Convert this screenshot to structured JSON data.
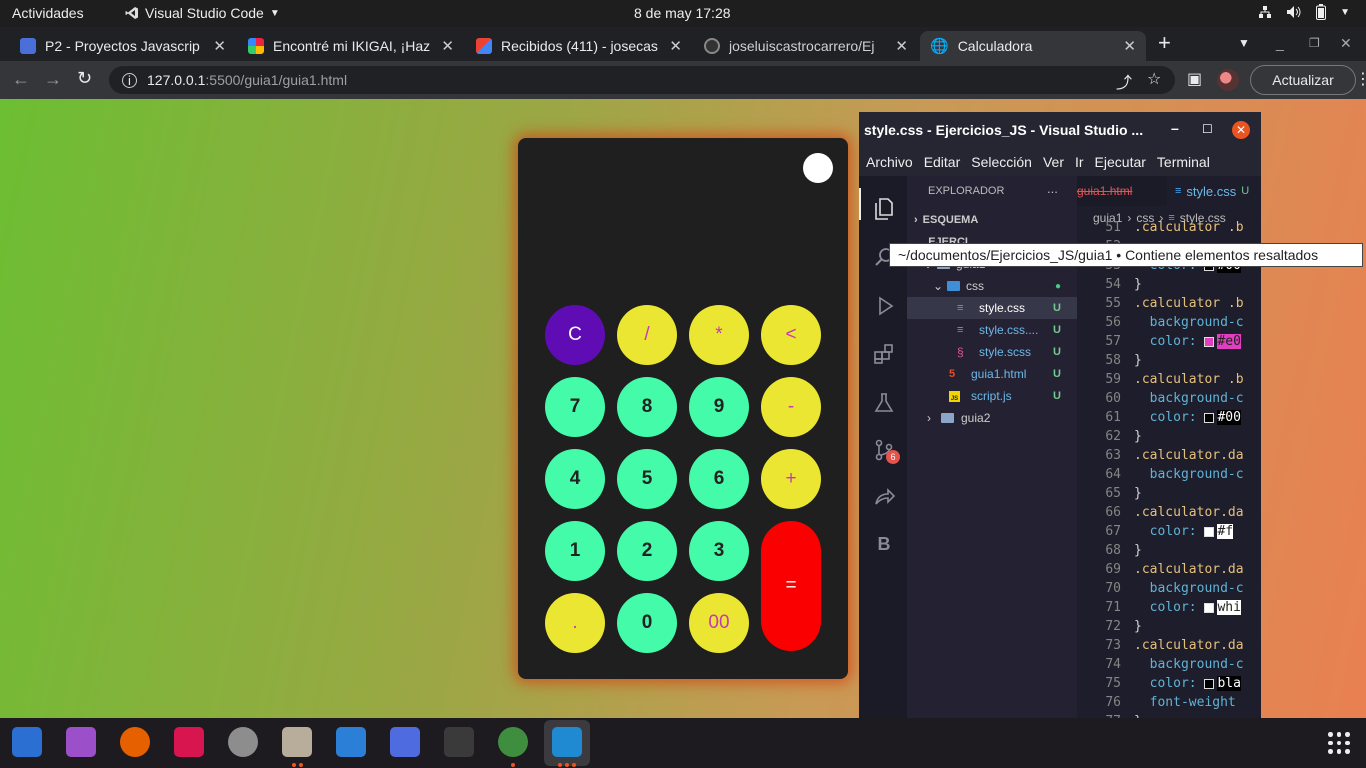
{
  "topbar": {
    "activities": "Actividades",
    "app": "Visual Studio Code",
    "app_menu_icon": "chevron-down-icon",
    "clock": "8 de may  17:28",
    "tray_icons": [
      "network-icon",
      "volume-icon",
      "battery-icon",
      "chevron-down-icon"
    ]
  },
  "browser": {
    "tabs": [
      {
        "title": "P2 - Proyectos Javascrip",
        "icon": "site-icon"
      },
      {
        "title": "Encontré mi IKIGAI, ¡Haz",
        "icon": "site-icon"
      },
      {
        "title": "Recibidos (411) - josecas",
        "icon": "gmail-icon"
      },
      {
        "title": "joseluiscastrocarrero/Ej",
        "icon": "github-icon"
      },
      {
        "title": "Calculadora",
        "icon": "globe-icon",
        "active": true
      }
    ],
    "new_tab": "+",
    "url_host": "127.0.0.1",
    "url_rest": ":5500/guia1/guia1.html",
    "update_label": "Actualizar"
  },
  "calculator": {
    "rows": [
      [
        {
          "label": "C",
          "kind": "clear"
        },
        {
          "label": "/",
          "kind": "op"
        },
        {
          "label": "*",
          "kind": "op"
        },
        {
          "label": "<",
          "kind": "op"
        }
      ],
      [
        {
          "label": "7",
          "kind": "num"
        },
        {
          "label": "8",
          "kind": "num"
        },
        {
          "label": "9",
          "kind": "num"
        },
        {
          "label": "-",
          "kind": "op"
        }
      ],
      [
        {
          "label": "4",
          "kind": "num"
        },
        {
          "label": "5",
          "kind": "num"
        },
        {
          "label": "6",
          "kind": "num"
        },
        {
          "label": "+",
          "kind": "op"
        }
      ],
      [
        {
          "label": "1",
          "kind": "num"
        },
        {
          "label": "2",
          "kind": "num"
        },
        {
          "label": "3",
          "kind": "num"
        },
        {
          "label": "=",
          "kind": "eq"
        }
      ],
      [
        {
          "label": ".",
          "kind": "op"
        },
        {
          "label": "0",
          "kind": "num"
        },
        {
          "label": "00",
          "kind": "op"
        }
      ]
    ],
    "colors": {
      "num": "#43fba9",
      "op": "#ebe631",
      "clear": "#5f0cb4",
      "eq": "#fa0000"
    }
  },
  "vscode": {
    "title": "style.css - Ejercicios_JS - Visual Studio ...",
    "menu": [
      "Archivo",
      "Editar",
      "Selección",
      "Ver",
      "Ir",
      "Ejecutar",
      "Terminal"
    ],
    "explorer_label": "EXPLORADOR",
    "explorer_more": "...",
    "outline": "ESQUEMA",
    "project": "EJERCI...",
    "files": [
      {
        "name": "guia1",
        "kind": "folder"
      },
      {
        "name": "css",
        "kind": "folder",
        "badge": "●"
      },
      {
        "name": "style.css",
        "kind": "css",
        "badge": "U",
        "selected": true
      },
      {
        "name": "style.css....",
        "kind": "css",
        "badge": "U"
      },
      {
        "name": "style.scss",
        "kind": "scss",
        "badge": "U"
      },
      {
        "name": "guia1.html",
        "kind": "html",
        "badge": "U"
      },
      {
        "name": "script.js",
        "kind": "js",
        "badge": "U"
      },
      {
        "name": "guia2",
        "kind": "folder"
      }
    ],
    "editor_tabs": [
      {
        "name": "guia1.html"
      },
      {
        "name": "style.css",
        "badge": "U"
      }
    ],
    "breadcrumb": [
      "guia1",
      "css",
      "style.css"
    ],
    "scm_badge": "6",
    "code": [
      {
        "n": "51",
        "t": ".calculator .b"
      },
      {
        "n": "52",
        "t": ""
      },
      {
        "n": "53",
        "t": "  color: ",
        "sw": "#000000",
        "v": "#00"
      },
      {
        "n": "54",
        "t": "}"
      },
      {
        "n": "55",
        "t": ".calculator .b"
      },
      {
        "n": "56",
        "t": "  background-c"
      },
      {
        "n": "57",
        "t": "  color: ",
        "sw": "#e040c0",
        "v": "#e0"
      },
      {
        "n": "58",
        "t": "}"
      },
      {
        "n": "59",
        "t": ".calculator .b"
      },
      {
        "n": "60",
        "t": "  background-c"
      },
      {
        "n": "61",
        "t": "  color: ",
        "sw": "#000000",
        "v": "#00"
      },
      {
        "n": "62",
        "t": "}"
      },
      {
        "n": "63",
        "t": ".calculator.da"
      },
      {
        "n": "64",
        "t": "  background-c"
      },
      {
        "n": "65",
        "t": "}"
      },
      {
        "n": "66",
        "t": ".calculator.da"
      },
      {
        "n": "67",
        "t": "  color: ",
        "sw": "#ffffff",
        "v": "#f"
      },
      {
        "n": "68",
        "t": "}"
      },
      {
        "n": "69",
        "t": ".calculator.da"
      },
      {
        "n": "70",
        "t": "  background-c"
      },
      {
        "n": "71",
        "t": "  color: ",
        "sw": "#ffffff",
        "v": "whi"
      },
      {
        "n": "72",
        "t": "}"
      },
      {
        "n": "73",
        "t": ".calculator.da"
      },
      {
        "n": "74",
        "t": "  background-c"
      },
      {
        "n": "75",
        "t": "  color: ",
        "sw": "#000000",
        "v": "bla"
      },
      {
        "n": "76",
        "t": "  font-weight"
      },
      {
        "n": "77",
        "t": "}"
      },
      {
        "n": "78",
        "t": ".calculator.da"
      }
    ],
    "tooltip": "~/documentos/Ejercicios_JS/guia1 • Contiene elementos resaltados"
  },
  "dock": [
    {
      "name": "system-monitor-icon",
      "color": "#2a6fd1",
      "dots": 0
    },
    {
      "name": "video-player-icon",
      "color": "#9b4fc9",
      "dots": 0
    },
    {
      "name": "firefox-icon",
      "color": "#e66000",
      "dots": 0
    },
    {
      "name": "screenshot-icon",
      "color": "#d8154e",
      "dots": 0
    },
    {
      "name": "settings-icon",
      "color": "#8d8d8d",
      "dots": 0
    },
    {
      "name": "files-icon",
      "color": "#b8ad9a",
      "dots": 2
    },
    {
      "name": "document-viewer-icon",
      "color": "#2c7fd6",
      "dots": 0
    },
    {
      "name": "screenshot-tool-icon",
      "color": "#4f6be0",
      "dots": 0
    },
    {
      "name": "terminal-icon",
      "color": "#3a3a3a",
      "dots": 0
    },
    {
      "name": "chrome-icon",
      "color": "#3f8e3f",
      "dots": 1
    },
    {
      "name": "vscode-icon",
      "color": "#1f8ad2",
      "dots": 3,
      "active": true
    }
  ],
  "dock_apps_grid": "show-applications-icon"
}
